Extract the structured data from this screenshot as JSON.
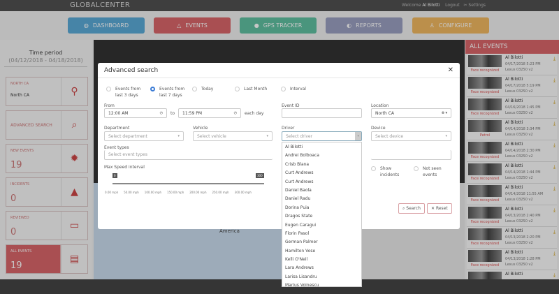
{
  "header": {
    "logo": "GLOBALCENTER",
    "welcome": "Welcome",
    "user": "Al Bilotti",
    "logout": "Logout",
    "settings": "Settings"
  },
  "nav": [
    {
      "label": "DASHBOARD",
      "color": "#5aa9d6"
    },
    {
      "label": "EVENTS",
      "color": "#d9666a"
    },
    {
      "label": "GPS TRACKER",
      "color": "#5fbfa0"
    },
    {
      "label": "REPORTS",
      "color": "#9a9fc0"
    },
    {
      "label": "CONFIGURE",
      "color": "#f0b860"
    }
  ],
  "sidebar": {
    "time_period": "Time period",
    "range": "(04/12/2018 - 04/18/2018)",
    "location": {
      "label": "NORTH CA",
      "value": "North CA"
    },
    "advanced": "ADVANCED SEARCH",
    "new_events": {
      "label": "NEW EVENTS",
      "value": "19"
    },
    "incidents": {
      "label": "INCIDENTS",
      "value": "0"
    },
    "reviewed": {
      "label": "REVIEWED",
      "value": "0"
    },
    "all_events": {
      "label": "ALL EVENTS",
      "value": "19"
    }
  },
  "map": {
    "label": "America"
  },
  "events_panel": {
    "title": "ALL EVENTS",
    "items": [
      {
        "name": "Al Bilotti",
        "tag": "Face recognized",
        "date": "04/17/2018 5:23 PM",
        "vehicle": "Lexus 03250 v2"
      },
      {
        "name": "Al Bilotti",
        "tag": "Face recognized",
        "date": "04/17/2018 5:19 PM",
        "vehicle": "Lexus 03250 v2"
      },
      {
        "name": "Al Bilotti",
        "tag": "Face recognized",
        "date": "04/16/2018 1:45 PM",
        "vehicle": "Lexus 03250 v2"
      },
      {
        "name": "Al Bilotti",
        "tag": "Petrol",
        "date": "04/14/2018 3:34 PM",
        "vehicle": "Lexus 03250 v2"
      },
      {
        "name": "Al Bilotti",
        "tag": "Face recognized",
        "date": "04/14/2018 2:30 PM",
        "vehicle": "Lexus 03250 v2"
      },
      {
        "name": "Al Bilotti",
        "tag": "Face recognized",
        "date": "04/14/2018 1:44 PM",
        "vehicle": "Lexus 03250 v2"
      },
      {
        "name": "Al Bilotti",
        "tag": "Face recognized",
        "date": "04/14/2018 11:55 AM",
        "vehicle": "Lexus 03250 v2"
      },
      {
        "name": "Al Bilotti",
        "tag": "Face recognized",
        "date": "04/13/2018 2:40 PM",
        "vehicle": "Lexus 03250 v2"
      },
      {
        "name": "Al Bilotti",
        "tag": "Face recognized",
        "date": "04/13/2018 2:20 PM",
        "vehicle": "Lexus 03250 v2"
      },
      {
        "name": "Al Bilotti",
        "tag": "Face recognized",
        "date": "04/13/2018 1:28 PM",
        "vehicle": "Lexus 03250 v2"
      },
      {
        "name": "Al Bilotti",
        "tag": "",
        "date": "",
        "vehicle": ""
      }
    ]
  },
  "modal": {
    "title": "Advanced search",
    "periods": [
      {
        "label": "Events from last 3 days",
        "checked": false
      },
      {
        "label": "Events from last 7 days",
        "checked": true
      },
      {
        "label": "Today",
        "checked": false
      },
      {
        "label": "Last Month",
        "checked": false
      },
      {
        "label": "Interval",
        "checked": false
      }
    ],
    "from_label": "From",
    "from": "12:00 AM",
    "to_label": "to",
    "to": "11:59 PM",
    "each_day": "each day",
    "event_id_label": "Event ID",
    "event_id": "",
    "location_label": "Location",
    "location": "North CA",
    "department_label": "Department",
    "department_ph": "Select department",
    "vehicle_label": "Vehicle",
    "vehicle_ph": "Select vehicle",
    "driver_label": "Driver",
    "driver_ph": "Select driver",
    "device_label": "Device",
    "device_ph": "Select device",
    "event_types_label": "Event types",
    "event_types_ph": "Select event types",
    "speed_label": "Max Speed interval",
    "speed_min": "0",
    "speed_max": "300",
    "speed_ticks": [
      "0.00 mph",
      "50.00 mph",
      "100.00 mph",
      "150.00 mph",
      "200.00 mph",
      "250.00 mph",
      "300.00 mph"
    ],
    "show_incidents": "Show incidents",
    "not_seen": "Not seen events",
    "search": "Search",
    "reset": "Reset",
    "drivers": [
      "Al Bilotti",
      "Andrei Bolboaca",
      "Crisb Blana",
      "Curt Andrews",
      "Curt Andrews",
      "Daniel Baola",
      "Daniel Radu",
      "Dorina Puia",
      "Dragos State",
      "Eugen Caragui",
      "Florin Pasol",
      "German Palmer",
      "Hamilton Vose",
      "Kelli O'Neil",
      "Lara Andrews",
      "Larisa Lisandru",
      "Marius Voinescu"
    ]
  }
}
